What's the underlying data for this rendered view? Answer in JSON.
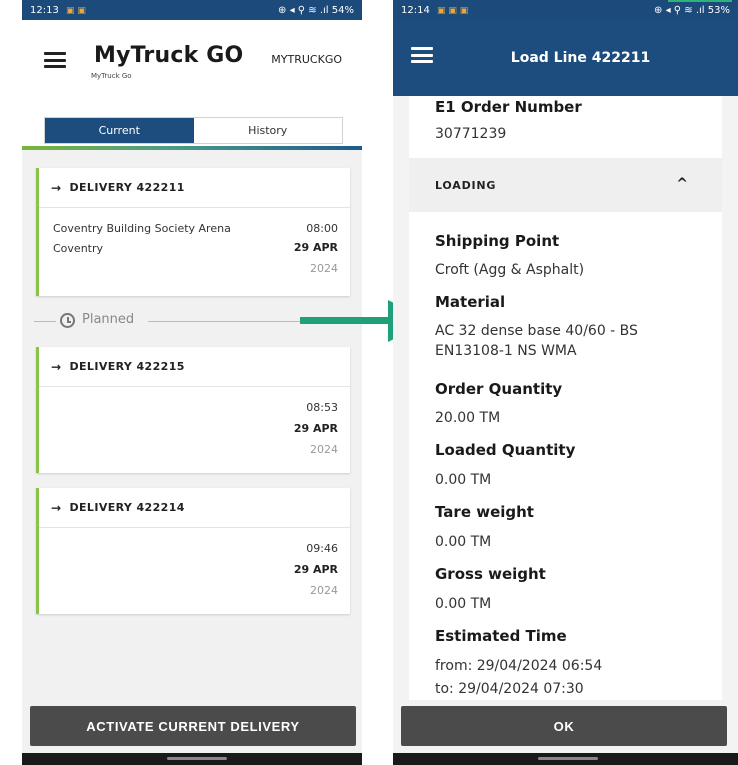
{
  "left_phone": {
    "status_bar": {
      "time": "12:13",
      "notifications": "▣ ▣",
      "icons": "⊕ ◂ ⚲ ≋ .ıl",
      "battery": "54%"
    },
    "header": {
      "app_name": "MyTruck GO",
      "app_subtitle": "MyTruck Go",
      "account": "MYTRUCKGO",
      "menu_icon": "hamburger-icon"
    },
    "tabs": [
      {
        "label": "Current",
        "active": true
      },
      {
        "label": "History",
        "active": false
      }
    ],
    "deliveries": [
      {
        "title": "DELIVERY 422211",
        "location": "Coventry Building Society Arena",
        "city": "Coventry",
        "time": "08:00",
        "date": "29 APR",
        "year": "2024"
      },
      {
        "title": "DELIVERY 422215",
        "location": "",
        "city": "",
        "time": "08:53",
        "date": "29 APR",
        "year": "2024"
      },
      {
        "title": "DELIVERY 422214",
        "location": "",
        "city": "",
        "time": "09:46",
        "date": "29 APR",
        "year": "2024"
      }
    ],
    "planned_label": "Planned",
    "action_button": "ACTIVATE CURRENT DELIVERY"
  },
  "right_phone": {
    "status_bar": {
      "time": "12:14",
      "notifications": "▣ ▣ ▣",
      "icons": "⊕ ◂ ⚲ ≋ .ıl",
      "battery": "53%"
    },
    "header": {
      "title": "Load Line 422211",
      "menu_icon": "hamburger-icon"
    },
    "order_number": {
      "label": "E1 Order Number",
      "value": "30771239"
    },
    "section": {
      "title": "LOADING",
      "toggle": "^"
    },
    "fields": {
      "shipping_point": {
        "label": "Shipping Point",
        "value": "Croft (Agg & Asphalt)"
      },
      "material": {
        "label": "Material",
        "value_line1": "AC 32 dense base 40/60 - BS",
        "value_line2": "EN13108-1 NS WMA"
      },
      "order_quantity": {
        "label": "Order Quantity",
        "value": "20.00 TM"
      },
      "loaded_quantity": {
        "label": "Loaded Quantity",
        "value": "0.00 TM"
      },
      "tare_weight": {
        "label": "Tare weight",
        "value": "0.00 TM"
      },
      "gross_weight": {
        "label": "Gross weight",
        "value": "0.00 TM"
      },
      "estimated_time": {
        "label": "Estimated Time",
        "from": "from: 29/04/2024 06:54",
        "to": "to: 29/04/2024 07:30"
      }
    },
    "action_button": "OK"
  },
  "colors": {
    "brand_blue": "#1d4c7e",
    "accent_green": "#8bc34a",
    "arrow_teal": "#1fa07a",
    "button_gray": "#4b4b4b"
  }
}
